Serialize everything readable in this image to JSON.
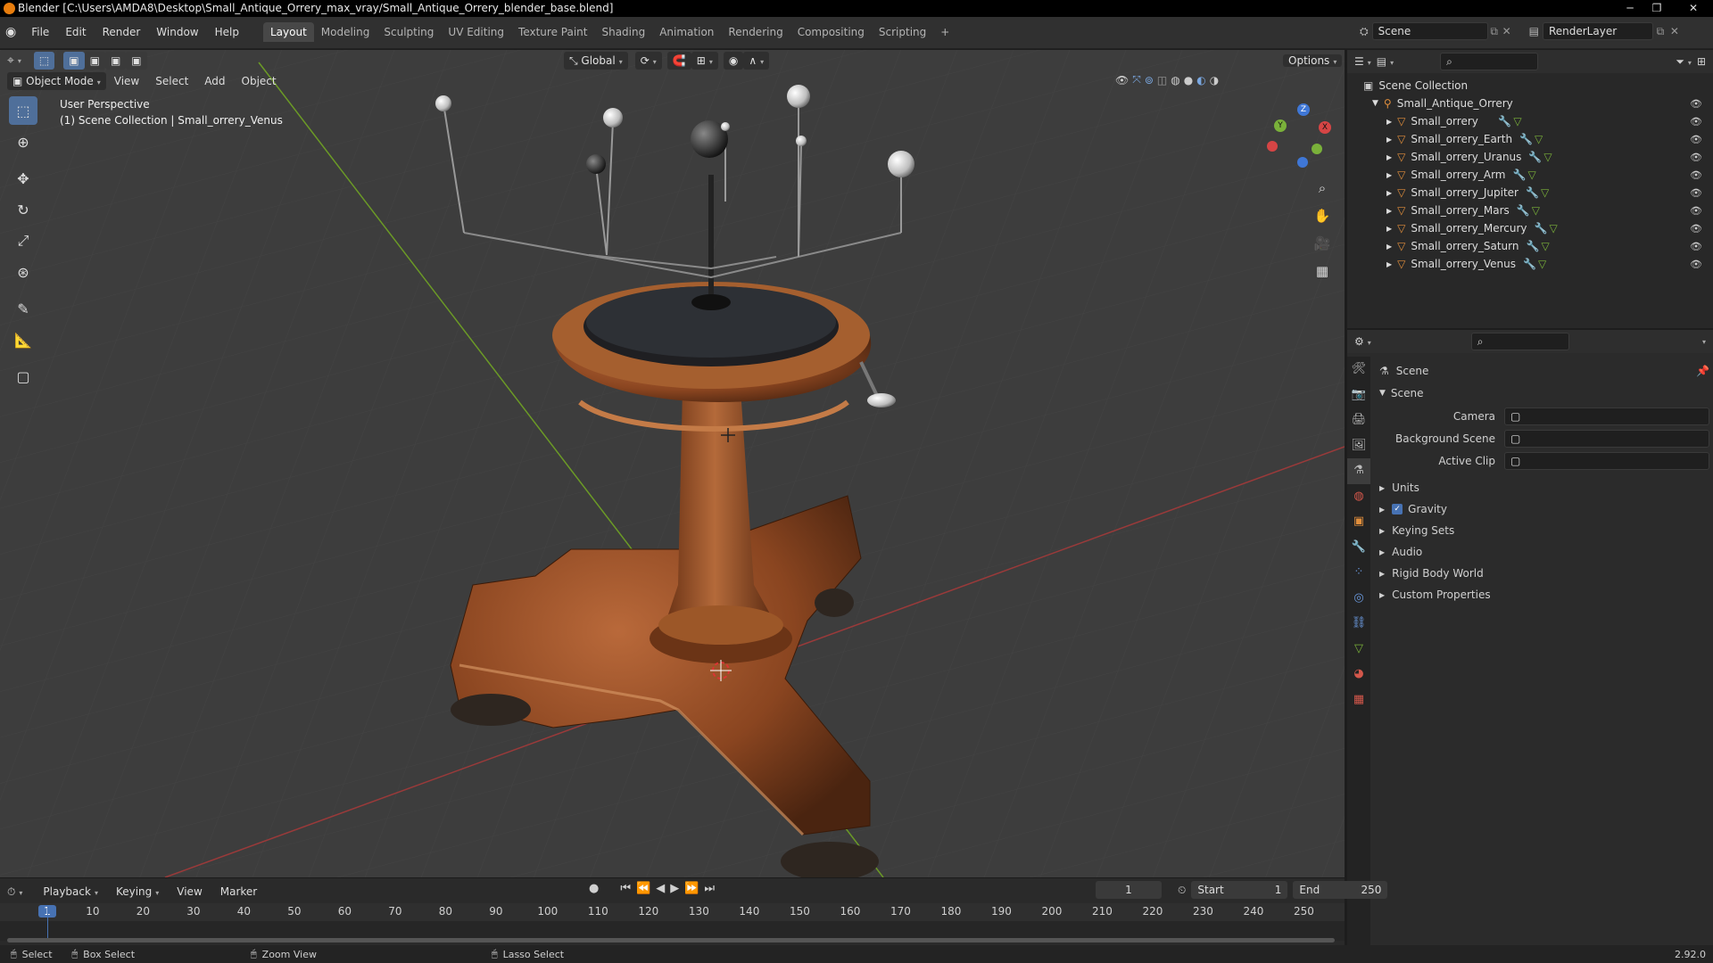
{
  "title_bar": {
    "text": "Blender [C:\\Users\\AMDA8\\Desktop\\Small_Antique_Orrery_max_vray/Small_Antique_Orrery_blender_base.blend]"
  },
  "menu": {
    "items": [
      "File",
      "Edit",
      "Render",
      "Window",
      "Help"
    ]
  },
  "workspaces": {
    "tabs": [
      "Layout",
      "Modeling",
      "Sculpting",
      "UV Editing",
      "Texture Paint",
      "Shading",
      "Animation",
      "Rendering",
      "Compositing",
      "Scripting"
    ],
    "active": "Layout"
  },
  "scene_field": "Scene",
  "render_layer_field": "RenderLayer",
  "header": {
    "transform": "Global",
    "options": "Options"
  },
  "viewport_header": {
    "mode": "Object Mode",
    "menus": [
      "View",
      "Select",
      "Add",
      "Object"
    ]
  },
  "overlay": {
    "perspective": "User Perspective",
    "context": "(1) Scene Collection | Small_orrery_Venus"
  },
  "gizmo": {
    "x": "X",
    "y": "Y",
    "z": "Z"
  },
  "outliner": {
    "root": "Scene Collection",
    "collection": "Small_Antique_Orrery",
    "objects": [
      "Small_orrery",
      "Small_orrery_Earth",
      "Small_orrery_Uranus",
      "Small_orrery_Arm",
      "Small_orrery_Jupiter",
      "Small_orrery_Mars",
      "Small_orrery_Mercury",
      "Small_orrery_Saturn",
      "Small_orrery_Venus"
    ]
  },
  "properties": {
    "context": "Scene",
    "panel": "Scene",
    "fields": [
      {
        "label": "Camera"
      },
      {
        "label": "Background Scene"
      },
      {
        "label": "Active Clip"
      }
    ],
    "sections": [
      "Units",
      "Gravity",
      "Keying Sets",
      "Audio",
      "Rigid Body World",
      "Custom Properties"
    ]
  },
  "timeline": {
    "menus": [
      "Playback",
      "Keying",
      "View",
      "Marker"
    ],
    "current_frame": "1",
    "start_label": "Start",
    "start": "1",
    "end_label": "End",
    "end": "250",
    "ruler": [
      "1",
      "10",
      "20",
      "30",
      "40",
      "50",
      "60",
      "70",
      "80",
      "90",
      "100",
      "110",
      "120",
      "130",
      "140",
      "150",
      "160",
      "170",
      "180",
      "190",
      "200",
      "210",
      "220",
      "230",
      "240",
      "250"
    ]
  },
  "statusbar": {
    "select": "Select",
    "box_select": "Box Select",
    "zoom_view": "Zoom View",
    "lasso_select": "Lasso Select",
    "version": "2.92.0"
  },
  "colors": {
    "accent": "#4772b3",
    "object_icon": "#e08e3c",
    "x_axis": "#d64545",
    "y_axis": "#7ab13a",
    "z_axis": "#3f77d6"
  }
}
